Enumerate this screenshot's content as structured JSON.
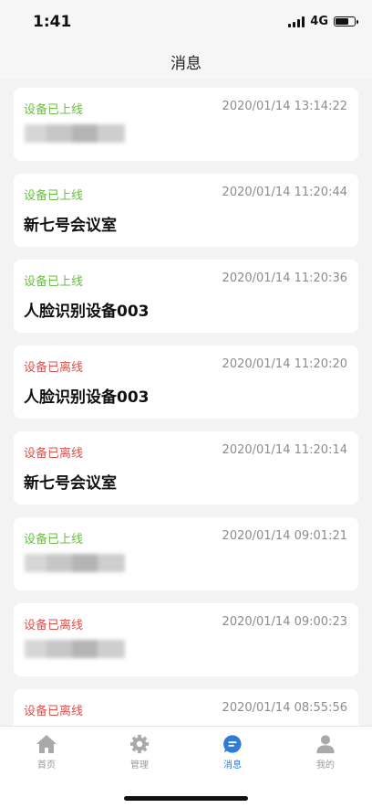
{
  "status_bar": {
    "time": "1:41",
    "network": "4G"
  },
  "header": {
    "title": "消息"
  },
  "messages": [
    {
      "status": "设备已上线",
      "status_type": "online",
      "timestamp": "2020/01/14 13:14:22",
      "device": ""
    },
    {
      "status": "设备已上线",
      "status_type": "online",
      "timestamp": "2020/01/14 11:20:44",
      "device": "新七号会议室"
    },
    {
      "status": "设备已上线",
      "status_type": "online",
      "timestamp": "2020/01/14 11:20:36",
      "device": "人脸识别设备003"
    },
    {
      "status": "设备已离线",
      "status_type": "offline",
      "timestamp": "2020/01/14 11:20:20",
      "device": "人脸识别设备003"
    },
    {
      "status": "设备已离线",
      "status_type": "offline",
      "timestamp": "2020/01/14 11:20:14",
      "device": "新七号会议室"
    },
    {
      "status": "设备已上线",
      "status_type": "online",
      "timestamp": "2020/01/14 09:01:21",
      "device": ""
    },
    {
      "status": "设备已离线",
      "status_type": "offline",
      "timestamp": "2020/01/14 09:00:23",
      "device": ""
    },
    {
      "status": "设备已离线",
      "status_type": "offline",
      "timestamp": "2020/01/14 08:55:56",
      "device": ""
    }
  ],
  "tabs": [
    {
      "label": "首页",
      "icon": "home-icon",
      "active": false
    },
    {
      "label": "管理",
      "icon": "gear-icon",
      "active": false
    },
    {
      "label": "消息",
      "icon": "message-icon",
      "active": true
    },
    {
      "label": "我的",
      "icon": "user-icon",
      "active": false
    }
  ],
  "colors": {
    "online": "#6cbd45",
    "offline": "#d9534f",
    "accent": "#2d7dd8"
  }
}
